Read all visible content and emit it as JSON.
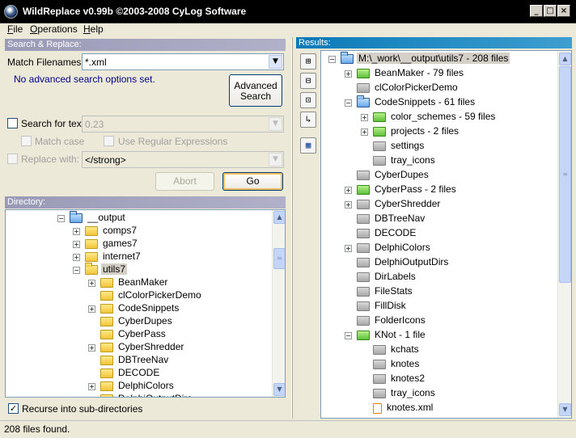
{
  "window": {
    "title": "WildReplace v0.99b ©2003-2008 CyLog Software",
    "minimize": "_",
    "maximize": "□",
    "close": "×"
  },
  "menu": [
    "File",
    "Operations",
    "Help"
  ],
  "search": {
    "header": "Search & Replace:",
    "match_filenames_label": "Match Filenames:",
    "match_filenames_value": "*.xml",
    "advanced_note": "No advanced search options set.",
    "advanced_button": "Advanced Search",
    "search_text_label": "Search for text:",
    "search_text_value": "0.23",
    "match_case_label": "Match case",
    "regex_label": "Use Regular Expressions",
    "replace_label": "Replace with:",
    "replace_value": "</strong>",
    "abort_button": "Abort",
    "go_button": "Go"
  },
  "directory": {
    "header": "Directory:",
    "recurse_label": "Recurse into sub-directories",
    "recurse_checked": true,
    "nodes": [
      {
        "label": "__output",
        "icon": "folder-blue",
        "expander": "minus",
        "level": 0
      },
      {
        "label": "comps7",
        "icon": "folder",
        "expander": "plus",
        "level": 1
      },
      {
        "label": "games7",
        "icon": "folder",
        "expander": "plus",
        "level": 1
      },
      {
        "label": "internet7",
        "icon": "folder",
        "expander": "plus",
        "level": 1
      },
      {
        "label": "utils7",
        "icon": "folder-open",
        "expander": "minus",
        "level": 1,
        "selected": true
      },
      {
        "label": "BeanMaker",
        "icon": "folder",
        "expander": "plus",
        "level": 2
      },
      {
        "label": "clColorPickerDemo",
        "icon": "folder",
        "expander": "",
        "level": 2
      },
      {
        "label": "CodeSnippets",
        "icon": "folder",
        "expander": "plus",
        "level": 2
      },
      {
        "label": "CyberDupes",
        "icon": "folder",
        "expander": "",
        "level": 2
      },
      {
        "label": "CyberPass",
        "icon": "folder",
        "expander": "",
        "level": 2
      },
      {
        "label": "CyberShredder",
        "icon": "folder",
        "expander": "plus",
        "level": 2
      },
      {
        "label": "DBTreeNav",
        "icon": "folder",
        "expander": "",
        "level": 2
      },
      {
        "label": "DECODE",
        "icon": "folder",
        "expander": "",
        "level": 2
      },
      {
        "label": "DelphiColors",
        "icon": "folder",
        "expander": "plus",
        "level": 2
      },
      {
        "label": "DelphiOutputDirs",
        "icon": "folder",
        "expander": "",
        "level": 2
      }
    ]
  },
  "results": {
    "header": "Results:",
    "nodes": [
      {
        "label": "M:\\_work\\__output\\utils7 - 208 files",
        "icon": "folder-blue",
        "expander": "minus",
        "level": 0,
        "selected": true
      },
      {
        "label": "BeanMaker - 79 files",
        "icon": "folder-green",
        "expander": "plus",
        "level": 1
      },
      {
        "label": "clColorPickerDemo",
        "icon": "folder-grey",
        "expander": "",
        "level": 1
      },
      {
        "label": "CodeSnippets - 61 files",
        "icon": "folder-blue",
        "expander": "minus",
        "level": 1
      },
      {
        "label": "color_schemes - 59 files",
        "icon": "folder-green",
        "expander": "plus",
        "level": 2
      },
      {
        "label": "projects - 2 files",
        "icon": "folder-green",
        "expander": "plus",
        "level": 2
      },
      {
        "label": "settings",
        "icon": "folder-grey",
        "expander": "",
        "level": 2
      },
      {
        "label": "tray_icons",
        "icon": "folder-grey",
        "expander": "",
        "level": 2
      },
      {
        "label": "CyberDupes",
        "icon": "folder-grey",
        "expander": "",
        "level": 1
      },
      {
        "label": "CyberPass - 2 files",
        "icon": "folder-green",
        "expander": "plus",
        "level": 1
      },
      {
        "label": "CyberShredder",
        "icon": "folder-grey",
        "expander": "plus",
        "level": 1
      },
      {
        "label": "DBTreeNav",
        "icon": "folder-grey",
        "expander": "",
        "level": 1
      },
      {
        "label": "DECODE",
        "icon": "folder-grey",
        "expander": "",
        "level": 1
      },
      {
        "label": "DelphiColors",
        "icon": "folder-grey",
        "expander": "plus",
        "level": 1
      },
      {
        "label": "DelphiOutputDirs",
        "icon": "folder-grey",
        "expander": "",
        "level": 1
      },
      {
        "label": "DirLabels",
        "icon": "folder-grey",
        "expander": "",
        "level": 1
      },
      {
        "label": "FileStats",
        "icon": "folder-grey",
        "expander": "",
        "level": 1
      },
      {
        "label": "FillDisk",
        "icon": "folder-grey",
        "expander": "",
        "level": 1
      },
      {
        "label": "FolderIcons",
        "icon": "folder-grey",
        "expander": "",
        "level": 1
      },
      {
        "label": "KNot - 1 file",
        "icon": "folder-green",
        "expander": "minus",
        "level": 1
      },
      {
        "label": "kchats",
        "icon": "folder-grey",
        "expander": "",
        "level": 2
      },
      {
        "label": "knotes",
        "icon": "folder-grey",
        "expander": "",
        "level": 2
      },
      {
        "label": "knotes2",
        "icon": "folder-grey",
        "expander": "",
        "level": 2
      },
      {
        "label": "tray_icons",
        "icon": "folder-grey",
        "expander": "",
        "level": 2
      },
      {
        "label": "knotes.xml",
        "icon": "file",
        "expander": "",
        "level": 2
      }
    ]
  },
  "toolbar_icons": [
    "expand-all-icon",
    "collapse-all-icon",
    "expand-found-icon",
    "tree-level-icon",
    "view-grid-icon"
  ],
  "status": "208 files found.",
  "colors": {
    "panel_header_grey": "#a6a6c4",
    "panel_header_blue": "#1b86c2",
    "link_text": "#00008b"
  }
}
